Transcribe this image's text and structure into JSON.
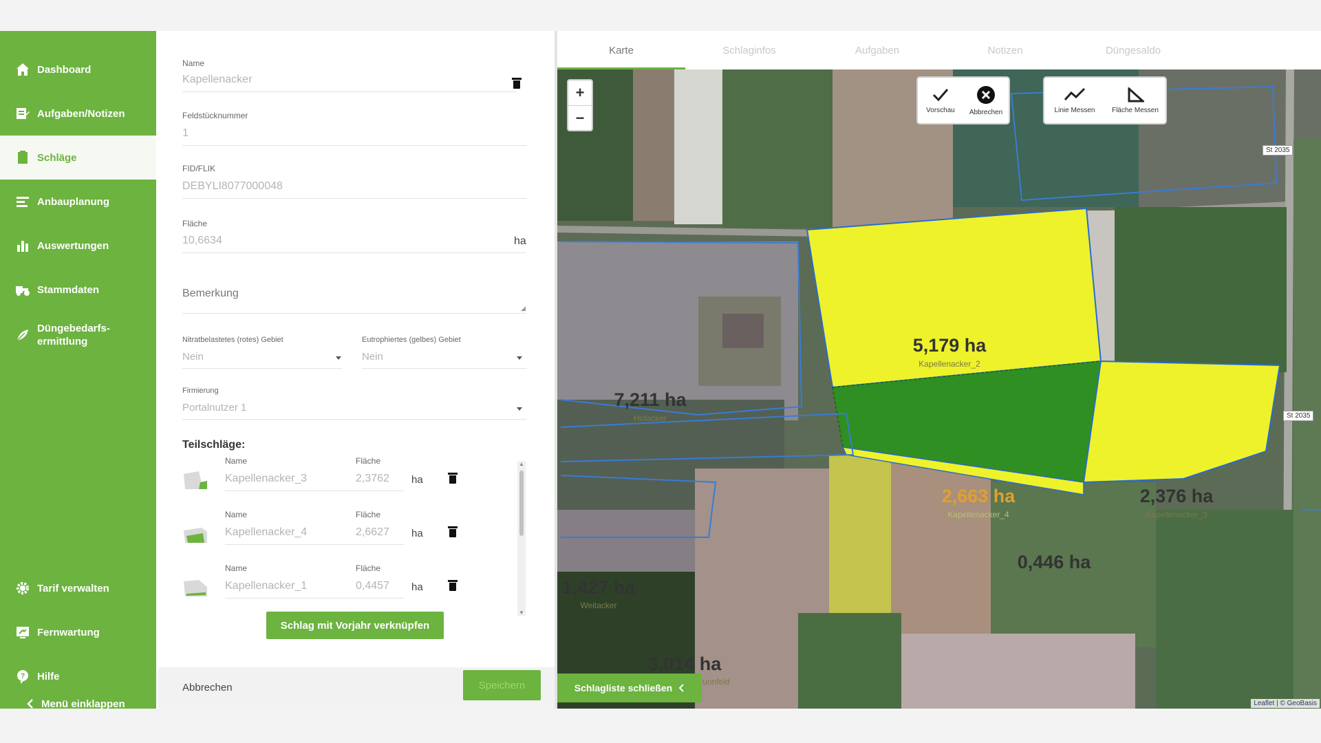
{
  "sidebar": {
    "items": [
      {
        "label": "Dashboard",
        "icon": "home-icon"
      },
      {
        "label": "Aufgaben/Notizen",
        "icon": "tasks-icon"
      },
      {
        "label": "Schläge",
        "icon": "fields-icon",
        "active": true
      },
      {
        "label": "Anbauplanung",
        "icon": "planning-icon"
      },
      {
        "label": "Auswertungen",
        "icon": "chart-icon"
      },
      {
        "label": "Stammdaten",
        "icon": "master-data-icon"
      },
      {
        "label_line1": "Düngebedarfs-",
        "label_line2": "ermittlung",
        "icon": "fertilizer-icon"
      }
    ],
    "bottom": [
      {
        "label": "Tarif verwalten",
        "icon": "gear-icon"
      },
      {
        "label": "Fernwartung",
        "icon": "remote-icon"
      },
      {
        "label": "Hilfe",
        "icon": "help-icon"
      },
      {
        "label": "Menü einklappen",
        "icon": "chevron-left-icon"
      }
    ]
  },
  "form": {
    "name_label": "Name",
    "name_value": "Kapellenacker",
    "field_number_label": "Feldstücknummer",
    "field_number_value": "1",
    "fid_label": "FID/FLIK",
    "fid_value": "DEBYLI8077000048",
    "area_label": "Fläche",
    "area_value": "10,6634",
    "area_unit": "ha",
    "remark_label": "Bemerkung",
    "nitrate_label": "Nitratbelastetes (rotes) Gebiet",
    "nitrate_value": "Nein",
    "eutroph_label": "Eutrophiertes (gelbes) Gebiet",
    "eutroph_value": "Nein",
    "company_label": "Firmierung",
    "company_value": "Portalnutzer 1",
    "sub_fields_title": "Teilschläge:",
    "sub_name_label": "Name",
    "sub_area_label": "Fläche",
    "sub_unit": "ha",
    "sub_fields": [
      {
        "name": "Kapellenacker_3",
        "area": "2,3762"
      },
      {
        "name": "Kapellenacker_4",
        "area": "2,6627"
      },
      {
        "name": "Kapellenacker_1",
        "area": "0,4457"
      }
    ],
    "link_button": "Schlag mit Vorjahr verknüpfen",
    "cancel_label": "Abbrechen",
    "save_label": "Speichern"
  },
  "tabs": [
    "Karte",
    "Schlaginfos",
    "Aufgaben",
    "Notizen",
    "Düngesaldo"
  ],
  "map": {
    "zoom_in": "+",
    "zoom_out": "−",
    "tool_preview": "Vorschau",
    "tool_cancel": "Abbrechen",
    "tool_line": "Linie Messen",
    "tool_area": "Fläche Messen",
    "areas": [
      {
        "value": "5,179 ha",
        "name": "Kapellenacker_2"
      },
      {
        "value": "7,211 ha",
        "name": "Hofacker"
      },
      {
        "value": "2,663 ha",
        "name": "Kapellenacker_4"
      },
      {
        "value": "2,376 ha",
        "name": "Kapellenacker_3"
      },
      {
        "value": "0,446 ha",
        "name": ""
      },
      {
        "value": "1,427 ha",
        "name": "Weitacker"
      },
      {
        "value": "3,014 ha",
        "name": "Brunnfeld"
      }
    ],
    "road_tag_1": "St 2035",
    "road_tag_2": "St 2035",
    "close_list": "Schlagliste schließen",
    "attribution": "Leaflet | © GeoBasis"
  },
  "colors": {
    "brand_green": "#6cb33f",
    "field_yellow": "#eef22a",
    "field_dark_green": "#2f8f22"
  }
}
